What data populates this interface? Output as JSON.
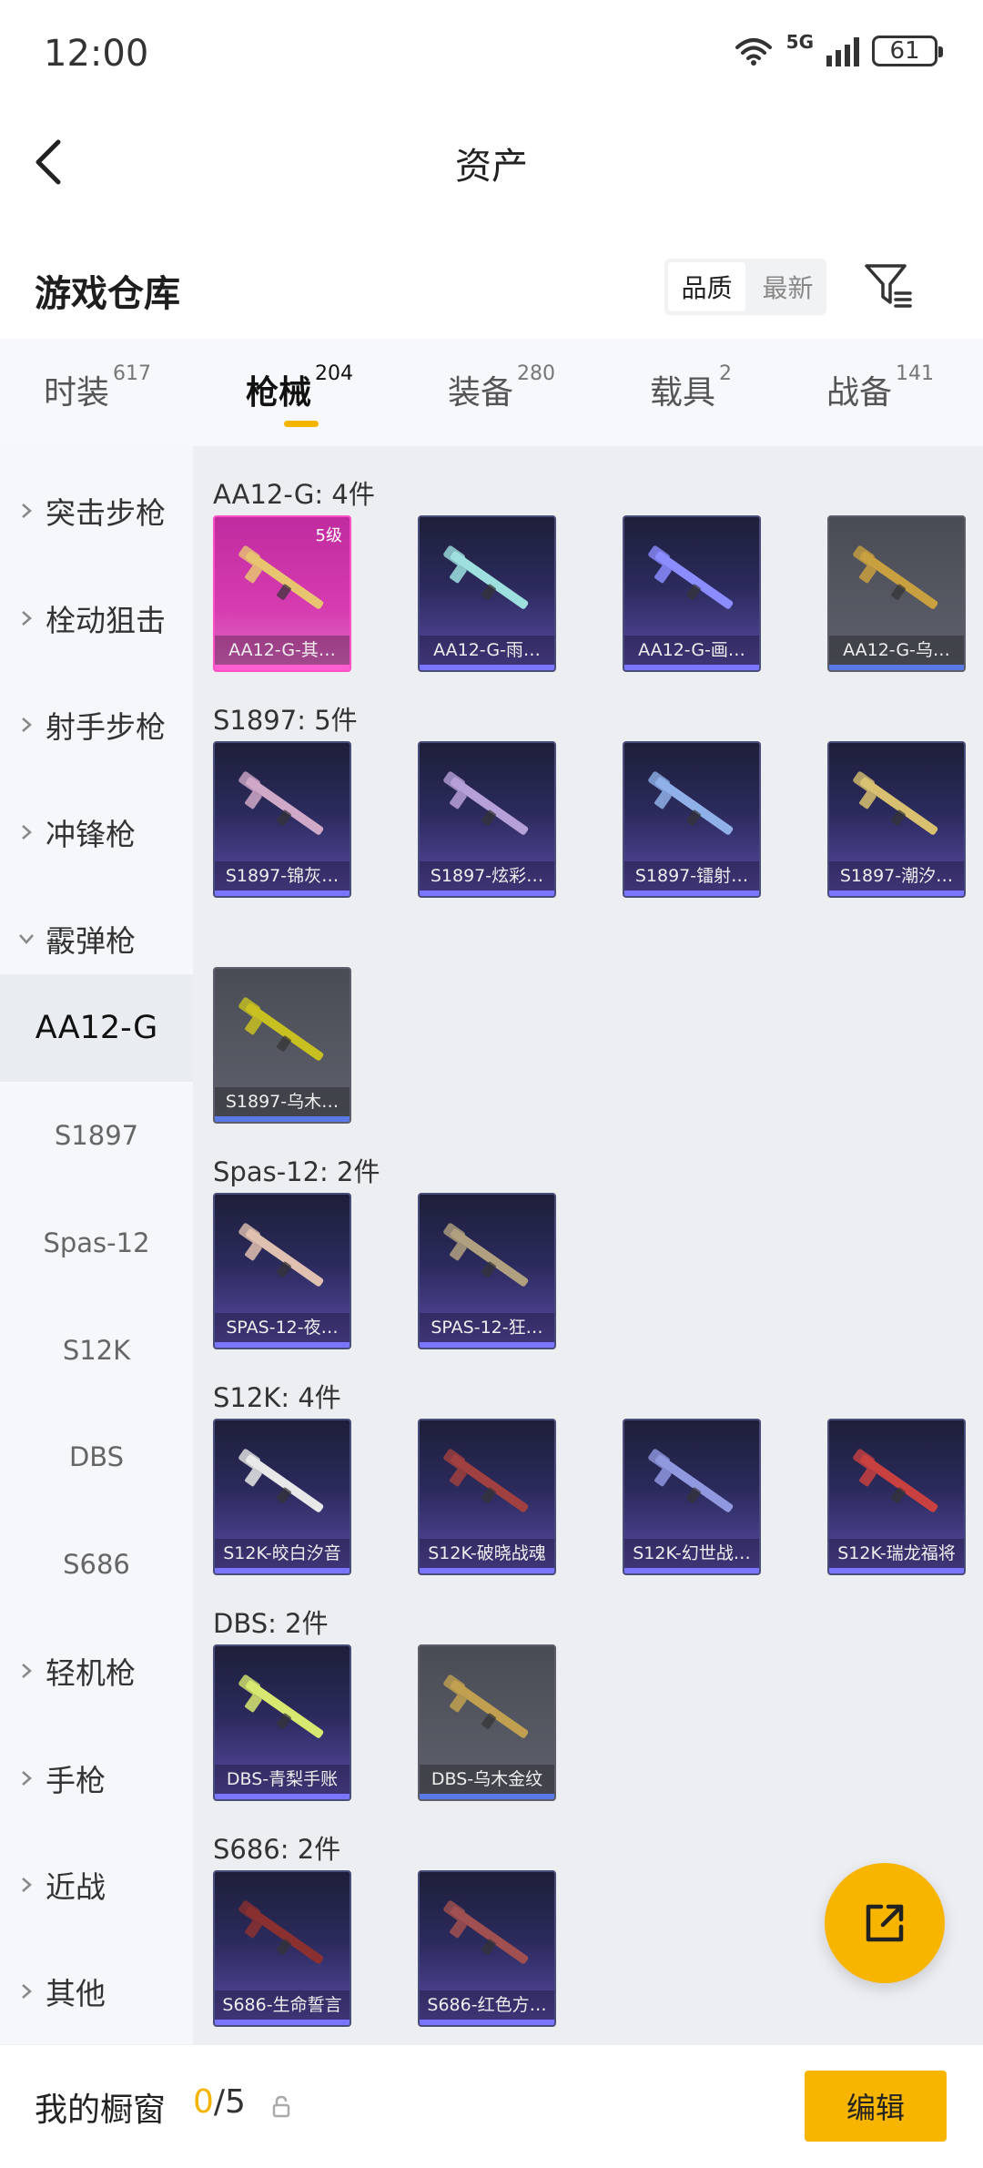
{
  "status": {
    "time": "12:00",
    "network": "5G",
    "battery": "61"
  },
  "nav": {
    "title": "资产"
  },
  "warehouse": {
    "title": "游戏仓库",
    "sort_options": [
      "品质",
      "最新"
    ],
    "active_sort": "品质"
  },
  "tabs": [
    {
      "label": "时装",
      "count": "617"
    },
    {
      "label": "枪械",
      "count": "204"
    },
    {
      "label": "装备",
      "count": "280"
    },
    {
      "label": "载具",
      "count": "2"
    },
    {
      "label": "战备",
      "count": "141"
    }
  ],
  "sidebar": {
    "categories": [
      "突击步枪",
      "栓动狙击",
      "射手步枪",
      "冲锋枪",
      "霰弹枪"
    ],
    "expanded": "霰弹枪",
    "subitems": [
      "AA12-G",
      "S1897",
      "Spas-12",
      "S12K",
      "DBS",
      "S686"
    ],
    "active_sub": "AA12-G",
    "more_categories": [
      "轻机枪",
      "手枪",
      "近战",
      "其他"
    ]
  },
  "groups": [
    {
      "title": "AA12-G: 4件",
      "items": [
        {
          "name": "AA12-G-其…",
          "style": "pink",
          "level": "5级"
        },
        {
          "name": "AA12-G-雨…",
          "style": "purple"
        },
        {
          "name": "AA12-G-画…",
          "style": "purple"
        },
        {
          "name": "AA12-G-乌…",
          "style": "gray"
        }
      ]
    },
    {
      "title": "S1897: 5件",
      "items": [
        {
          "name": "S1897-锦灰…",
          "style": "purple"
        },
        {
          "name": "S1897-炫彩…",
          "style": "purple"
        },
        {
          "name": "S1897-镭射…",
          "style": "purple"
        },
        {
          "name": "S1897-潮汐…",
          "style": "purple"
        },
        {
          "name": "S1897-乌木…",
          "style": "gray"
        }
      ]
    },
    {
      "title": "Spas-12: 2件",
      "items": [
        {
          "name": "SPAS-12-夜…",
          "style": "purple"
        },
        {
          "name": "SPAS-12-狂…",
          "style": "purple"
        }
      ]
    },
    {
      "title": "S12K: 4件",
      "items": [
        {
          "name": "S12K-皎白汐音",
          "style": "purple"
        },
        {
          "name": "S12K-破晓战魂",
          "style": "purple"
        },
        {
          "name": "S12K-幻世战…",
          "style": "purple"
        },
        {
          "name": "S12K-瑞龙福将",
          "style": "purple"
        }
      ]
    },
    {
      "title": "DBS: 2件",
      "items": [
        {
          "name": "DBS-青梨手账",
          "style": "purple"
        },
        {
          "name": "DBS-乌木金纹",
          "style": "gray"
        }
      ]
    },
    {
      "title": "S686: 2件",
      "items": [
        {
          "name": "S686-生命誓言",
          "style": "purple"
        },
        {
          "name": "S686-红色方…",
          "style": "purple"
        }
      ]
    }
  ],
  "bottom": {
    "label": "我的橱窗",
    "current": "0",
    "total": "/5",
    "edit_label": "编辑"
  },
  "colors": {
    "accent": "#f7b500",
    "content_bg": "#eceef2",
    "sidebar_bg": "#f5f7fa"
  },
  "icons": {
    "back": "chevron-left-icon",
    "filter": "filter-icon",
    "share": "share-external-icon",
    "lock": "lock-icon"
  }
}
